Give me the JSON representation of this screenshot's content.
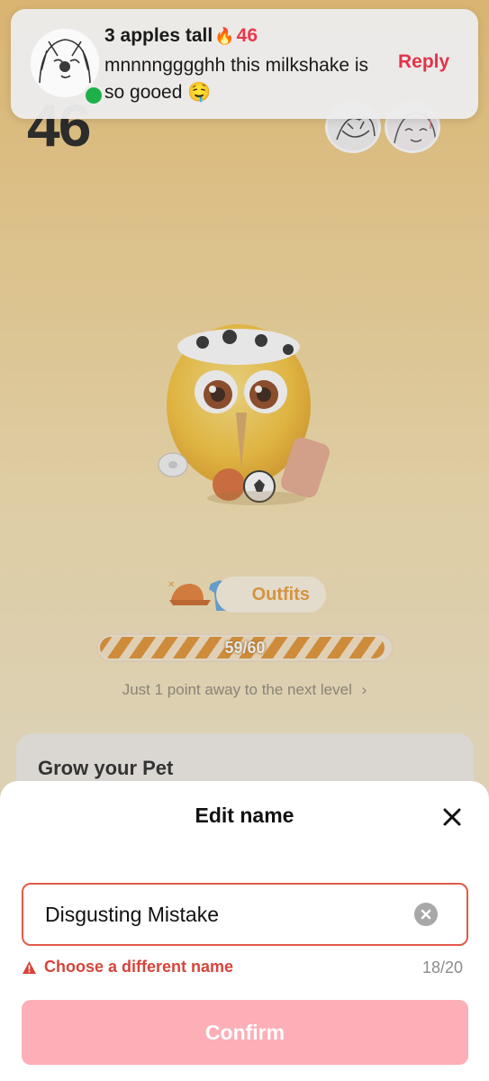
{
  "background": {
    "streak_number": "46",
    "outfits_label": "Outfits",
    "progress": {
      "text": "59/60",
      "fraction": 0.983
    },
    "next_level_text": "Just 1 point away to the next level",
    "grow_card_title": "Grow your Pet"
  },
  "notification": {
    "sender": "3 apples tall",
    "streak": "46",
    "message": "mnnnngggghh this milkshake is so gooed 🤤",
    "reply_label": "Reply",
    "colors": {
      "accent": "#e3334a",
      "online": "#1fb04a"
    }
  },
  "edit_sheet": {
    "title": "Edit name",
    "input_value": "Disgusting Mistake",
    "error_text": "Choose a different name",
    "char_count": "18/20",
    "confirm_label": "Confirm",
    "colors": {
      "error": "#d6453a",
      "confirm_disabled": "#fdaeb7"
    }
  },
  "icons": {
    "close": "close-icon",
    "clear": "clear-icon",
    "warning": "warning-icon",
    "fire": "fire-icon",
    "chevron": "chevron-right-icon"
  }
}
